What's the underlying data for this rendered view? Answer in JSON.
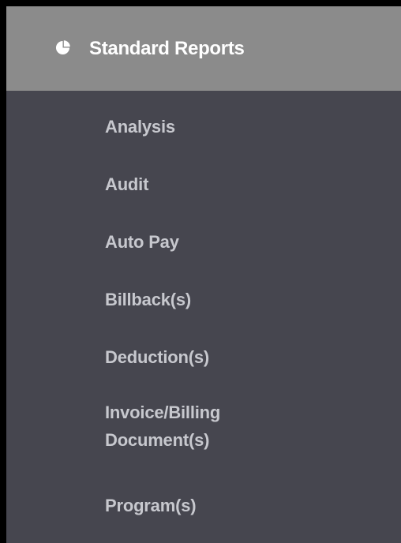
{
  "menu": {
    "header": {
      "icon": "pie-chart-icon",
      "label": "Standard Reports"
    },
    "items": [
      {
        "label": "Analysis"
      },
      {
        "label": "Audit"
      },
      {
        "label": "Auto Pay"
      },
      {
        "label": "Billback(s)"
      },
      {
        "label": "Deduction(s)"
      },
      {
        "label": "Invoice/Billing Document(s)"
      },
      {
        "label": "Program(s)"
      }
    ]
  },
  "colors": {
    "page_border": "#000000",
    "header_background": "#8b8b8b",
    "panel_background": "#46464f",
    "header_text": "#ffffff",
    "item_text": "#c7c8ce"
  }
}
